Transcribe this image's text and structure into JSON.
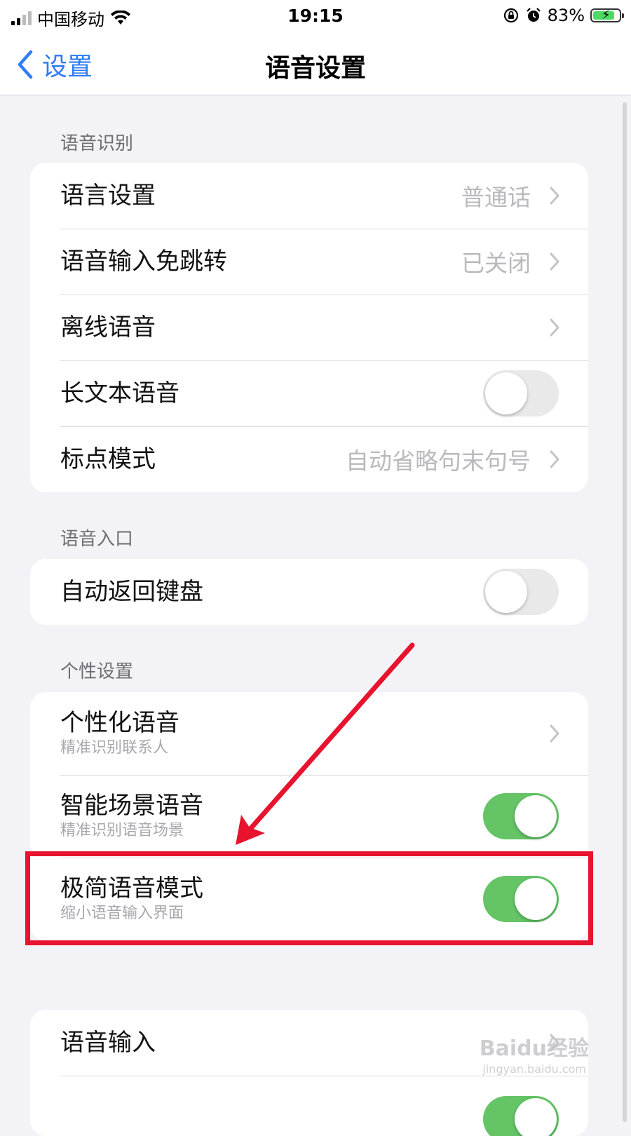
{
  "status_bar": {
    "carrier": "中国移动",
    "time": "19:15",
    "battery_percent": "83%",
    "battery_level": 0.83,
    "icons": [
      "signal-icon",
      "wifi-icon",
      "rotation-lock-icon",
      "alarm-icon",
      "battery-charging-icon"
    ]
  },
  "nav": {
    "back_label": "设置",
    "title": "语音设置"
  },
  "sections": {
    "recognition": {
      "header": "语音识别",
      "rows": [
        {
          "label": "语言设置",
          "value": "普通话"
        },
        {
          "label": "语音输入免跳转",
          "value": "已关闭"
        },
        {
          "label": "离线语音"
        },
        {
          "label": "长文本语音",
          "toggle": false
        },
        {
          "label": "标点模式",
          "value": "自动省略句末句号"
        }
      ]
    },
    "entry": {
      "header": "语音入口",
      "rows": [
        {
          "label": "自动返回键盘",
          "toggle": false
        }
      ]
    },
    "personal": {
      "header": "个性设置",
      "rows": [
        {
          "label": "个性化语音",
          "sub": "精准识别联系人"
        },
        {
          "label": "智能场景语音",
          "sub": "精准识别语音场景",
          "toggle": true
        },
        {
          "label": "极简语音模式",
          "sub": "缩小语音输入界面",
          "toggle": true
        }
      ]
    },
    "input": {
      "rows": [
        {
          "label": "语音输入"
        },
        {
          "toggle": true
        }
      ]
    }
  },
  "watermark": {
    "brand": "Baidu经验",
    "url": "jingyan.baidu.com"
  },
  "colors": {
    "accent": "#2f7cf6",
    "toggle_on": "#64c466",
    "toggle_off": "#e9e9ea",
    "highlight": "#e8132e",
    "background": "#f2f2f7"
  }
}
